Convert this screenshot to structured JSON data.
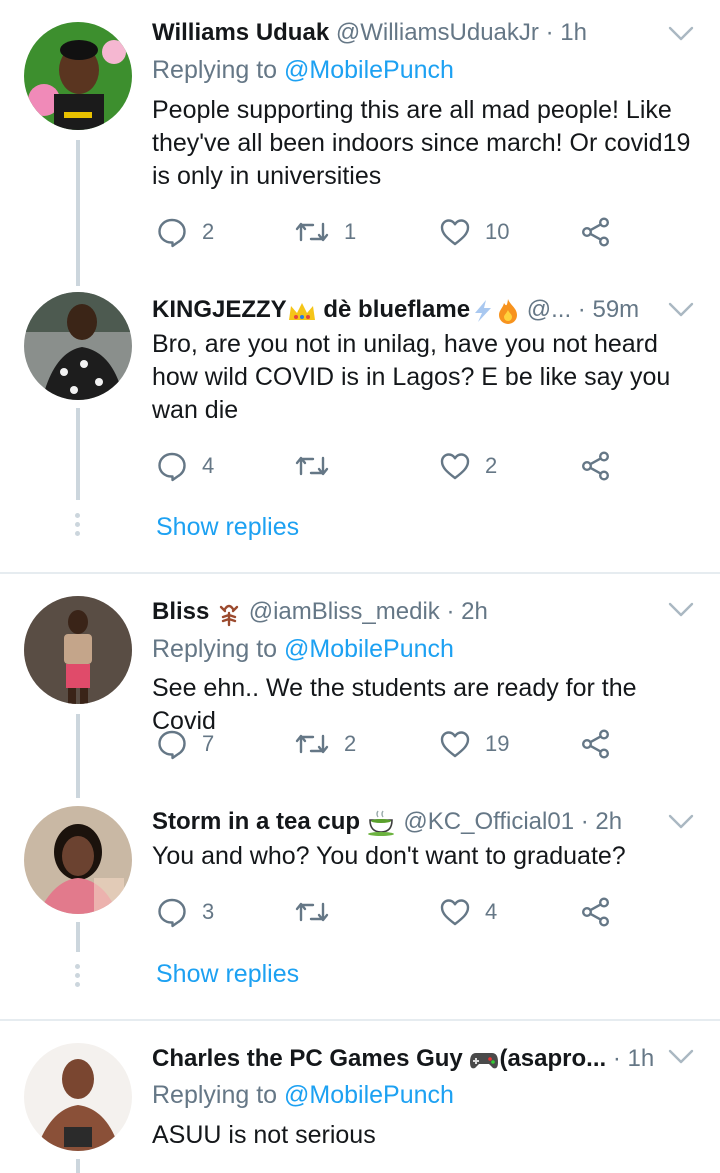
{
  "colors": {
    "accent": "#1da1f2",
    "muted": "#657786",
    "text": "#14171a",
    "line": "#ccd6dd"
  },
  "tweets": [
    {
      "name": "Williams Uduak",
      "handle": "@WilliamsUduakJr",
      "time": "1h",
      "reply_prefix": "Replying to",
      "reply_mention": "@MobilePunch",
      "text": "People supporting this are all mad people! Like they've all been indoors since march! Or covid19 is only in universities",
      "replies": "2",
      "retweets": "1",
      "likes": "10"
    },
    {
      "name": "KINGJEZZY",
      "name_suffix": "dè blueflame",
      "handle": "@...",
      "time": "59m",
      "text": "Bro, are you not in unilag, have you not heard how wild COVID is in Lagos? E be like say you wan die",
      "replies": "4",
      "retweets": "",
      "likes": "2"
    },
    {
      "name": "Bliss",
      "handle": "@iamBliss_medik",
      "time": "2h",
      "reply_prefix": "Replying to",
      "reply_mention": "@MobilePunch",
      "text": "See ehn.. We the students are ready for the Covid",
      "replies": "7",
      "retweets": "2",
      "likes": "19"
    },
    {
      "name": "Storm in a tea cup",
      "handle": "@KC_Official01",
      "time": "2h",
      "text": "You and who? You don't want to graduate?",
      "replies": "3",
      "retweets": "",
      "likes": "4"
    },
    {
      "name": "Charles the PC Games Guy",
      "name_suffix": "(asapro...",
      "time": "1h",
      "reply_prefix": "Replying to",
      "reply_mention": "@MobilePunch",
      "text": "ASUU is not serious"
    }
  ],
  "show_replies_label": "Show replies",
  "time_sep": "·",
  "icons": [
    "reply-icon",
    "retweet-icon",
    "like-icon",
    "share-icon",
    "chevron-down-icon"
  ]
}
